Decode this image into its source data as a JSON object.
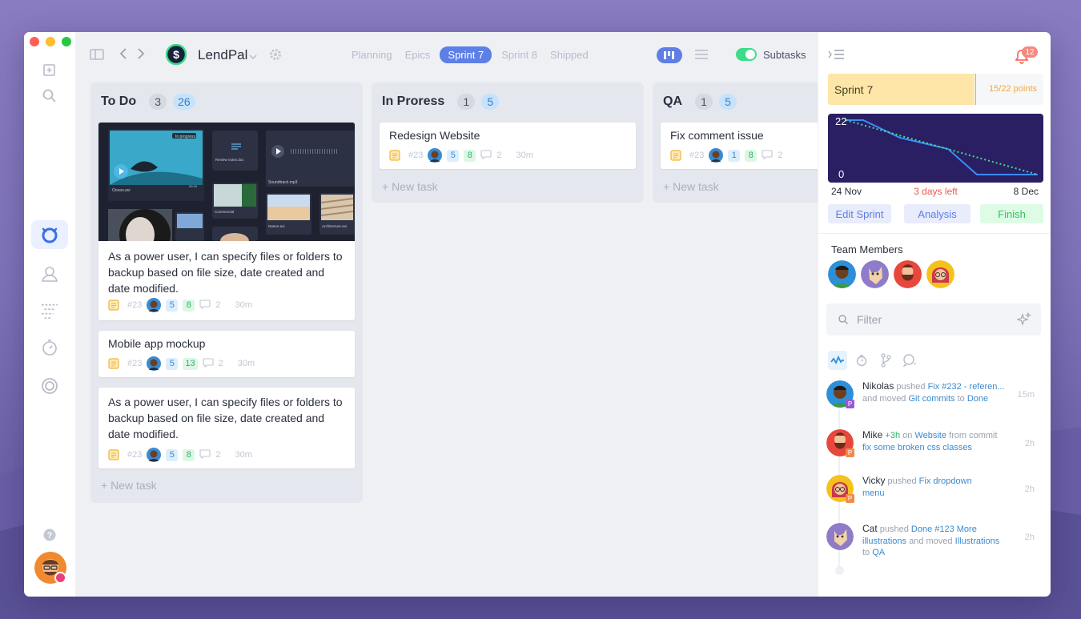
{
  "app": {
    "project": "LendPal"
  },
  "nav_tabs": [
    {
      "label": "Planning",
      "active": false
    },
    {
      "label": "Epics",
      "active": false
    },
    {
      "label": "Sprint 7",
      "active": true
    },
    {
      "label": "Sprint 8",
      "active": false
    },
    {
      "label": "Shipped",
      "active": false
    }
  ],
  "toolbar": {
    "subtasks_label": "Subtasks",
    "subtasks_on": true
  },
  "columns": [
    {
      "title": "To Do",
      "count": "3",
      "points": "26",
      "cards": [
        {
          "title": "As a power user, I can specify files or folders to backup based on file size, date created and date modified.",
          "id": "#23",
          "b": "5",
          "g": "8",
          "comments": "2",
          "time": "30m",
          "has_image": true
        },
        {
          "title": "Mobile app mockup",
          "id": "#23",
          "b": "5",
          "g": "13",
          "comments": "2",
          "time": "30m"
        },
        {
          "title": "As a power user, I can specify files or folders to backup based on file size, date created and date modified.",
          "id": "#23",
          "b": "5",
          "g": "8",
          "comments": "2",
          "time": "30m"
        }
      ],
      "new_task": "+ New task"
    },
    {
      "title": "In Proress",
      "count": "1",
      "points": "5",
      "cards": [
        {
          "title": "Redesign Website",
          "id": "#23",
          "b": "5",
          "g": "8",
          "comments": "2",
          "time": "30m"
        }
      ],
      "new_task": "+ New task"
    },
    {
      "title": "QA",
      "count": "1",
      "points": "5",
      "cards": [
        {
          "title": "Fix comment issue",
          "id": "#23",
          "b": "1",
          "g": "8",
          "comments": "2",
          "time": ""
        }
      ],
      "new_task": "+ New task"
    }
  ],
  "hero_labels": {
    "in_progress": "In progress",
    "file1": "Ocean.avi",
    "file2": "Review notes.doc",
    "file3": "Soundtrack.mp3",
    "file4": "Commercial",
    "file5": "Nature.avi",
    "file6": "Architecture.avi",
    "duration": "00:16"
  },
  "panel": {
    "notifications": "12",
    "sprint": {
      "name": "Sprint 7",
      "points": "15/22 points",
      "progress": 0.68
    },
    "burndown": {
      "top": "22",
      "bottom": "0",
      "start": "24 Nov",
      "left": "3 days left",
      "end": "8 Dec"
    },
    "buttons": {
      "edit": "Edit Sprint",
      "analysis": "Analysis",
      "finish": "Finish"
    },
    "members_label": "Team Members",
    "filter_placeholder": "Filter",
    "activity": [
      {
        "name": "Nikolas",
        "verb": " pushed ",
        "link": "Fix #232 - referen...",
        "rest": "and moved ",
        "link2": "Git commits",
        "rest2": " to ",
        "link3": "Done",
        "time": "15m",
        "badge": "P",
        "badge_color": "#9b59d0"
      },
      {
        "name": "Mike",
        "extra": " +3h ",
        "verb": " on ",
        "link": "Website",
        "rest": " from commit ",
        "link2": "fix some broken css classes",
        "time": "2h",
        "badge": "P",
        "badge_color": "#f08a4b"
      },
      {
        "name": "Vicky",
        "verb": " pushed ",
        "link": "Fix dropdown menu",
        "time": "2h",
        "badge": "P",
        "badge_color": "#f08a4b"
      },
      {
        "name": "Cat",
        "verb": " pushed ",
        "link": "Done #123 More illustrations",
        "rest": " and moved ",
        "link2": "Illustrations",
        "rest2": " to ",
        "link3": "QA",
        "time": "2h"
      }
    ]
  },
  "colors": {
    "accent": "#5d7fe6",
    "burndown_bg": "#2a1f63",
    "sprint_fill": "#fde6a8",
    "finish": "#2fc25b"
  }
}
